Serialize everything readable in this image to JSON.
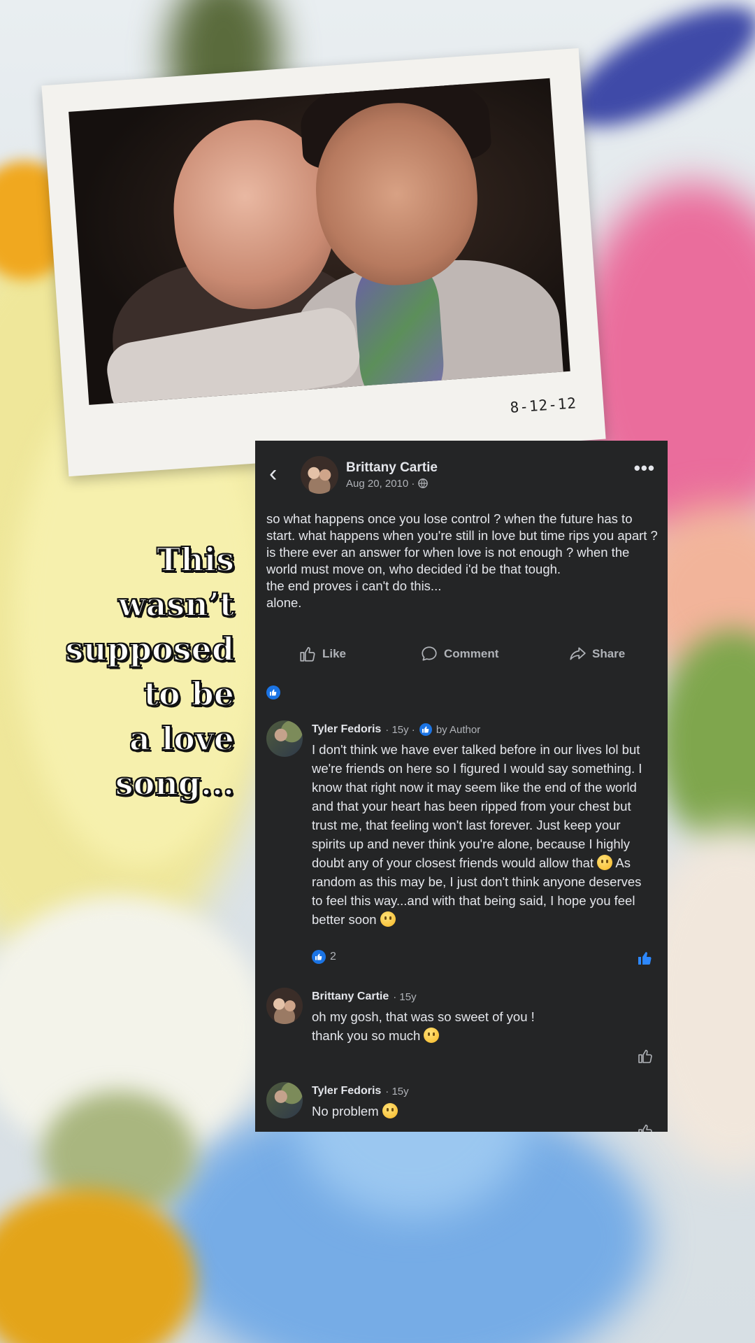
{
  "polaroid": {
    "date": "8-12-12"
  },
  "caption": {
    "lines": [
      "This",
      "wasn’t",
      "supposed",
      "to be",
      "a love",
      "song..."
    ]
  },
  "post": {
    "author": "Brittany Cartie",
    "date": "Aug 20, 2010 ·",
    "privacy_icon": "globe-icon",
    "text": "so what happens once you lose control ? when the future has to start. what happens when you're still in love but time rips you apart ? is there ever an answer for when love is not enough ? when the world must move on, who decided i'd be that tough.\nthe end proves i can't do this...\nalone.",
    "actions": {
      "like": "Like",
      "comment": "Comment",
      "share": "Share"
    }
  },
  "comments": [
    {
      "name": "Tyler Fedoris",
      "age": "· 15y ·",
      "badge": "by Author",
      "text": "I don't think we have ever talked before in our lives lol but we're friends on here so I figured I would say something. I know that right now it may seem like the end of the world and that your heart has been ripped from your chest but trust me, that feeling won't last forever. Just keep your spirits up and never think you're alone, because I highly doubt any of your closest friends would allow that",
      "text_after": " As random as this may be, I just don't think anyone deserves to feel this way...and with that being said, I hope you feel better soon",
      "likes": "2"
    },
    {
      "name": "Brittany Cartie",
      "age": "· 15y",
      "text": "oh my gosh, that was so sweet of you !\nthank you so much"
    },
    {
      "name": "Tyler Fedoris",
      "age": "· 15y",
      "text": "No problem"
    }
  ],
  "colors": {
    "card_bg": "#242526",
    "accent": "#1b74e4",
    "text": "#e4e6eb",
    "muted": "#b0b3b8"
  }
}
